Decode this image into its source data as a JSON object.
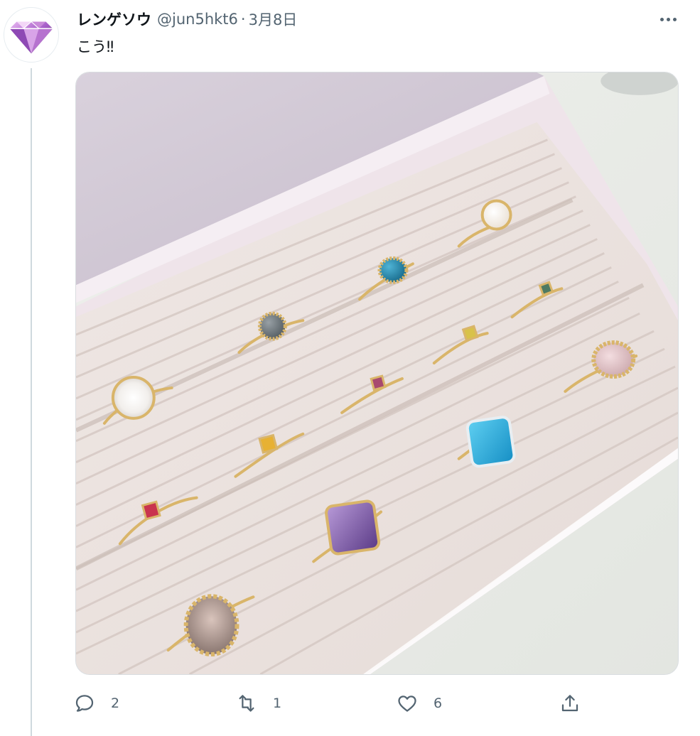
{
  "tweet": {
    "author_name": "レンゲソウ",
    "author_handle": "@jun5hkt6",
    "separator": "·",
    "date": "3月8日",
    "text": "こう‼"
  },
  "icons": {
    "avatar": "gem-diamond-avatar",
    "more": "more-dots-icon",
    "reply": "reply-bubble-icon",
    "retweet": "retweet-arrows-icon",
    "like": "heart-icon",
    "share": "share-upload-icon"
  },
  "actions": {
    "reply_count": "2",
    "retweet_count": "1",
    "like_count": "6"
  },
  "colors": {
    "text_primary": "#0f1419",
    "text_secondary": "#536471",
    "thread_line": "#cfd9de"
  }
}
